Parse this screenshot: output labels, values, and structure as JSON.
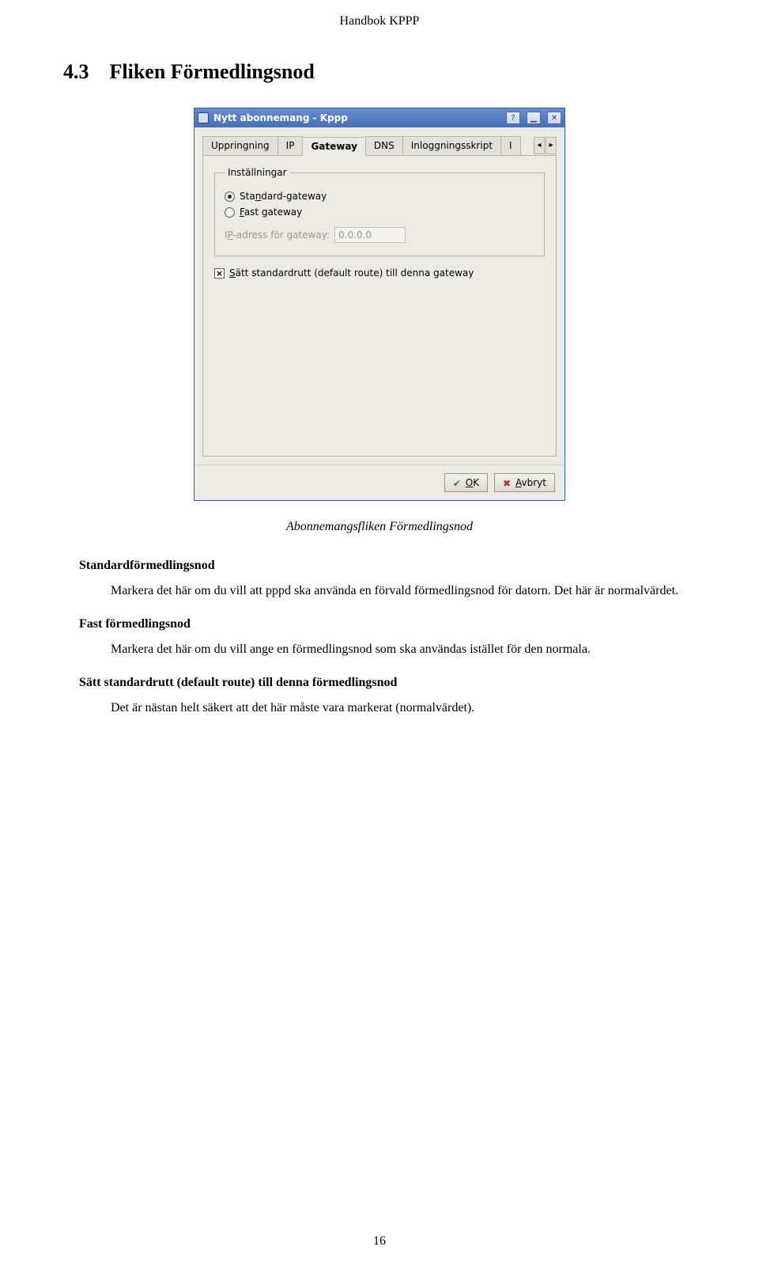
{
  "header": "Handbok KPPP",
  "section_number": "4.3",
  "section_title": "Fliken Förmedlingsnod",
  "window": {
    "title": "Nytt abonnemang - Kppp",
    "tabs": [
      "Uppringning",
      "IP",
      "Gateway",
      "DNS",
      "Inloggningsskript"
    ],
    "tab_overflow": "I",
    "fieldset_legend": "Inställningar",
    "radio_standard_pre": "Sta",
    "radio_standard_u": "n",
    "radio_standard_post": "dard-gateway",
    "radio_fast_u": "F",
    "radio_fast_post": "ast gateway",
    "ip_label_pre": "I",
    "ip_label_u": "P",
    "ip_label_post": "-adress för gateway:",
    "ip_value": "0.0.0.0",
    "defaultroute_u": "S",
    "defaultroute_post": "ätt standardrutt (default route) till denna gateway",
    "ok_u": "O",
    "ok_post": "K",
    "cancel_u": "A",
    "cancel_post": "vbryt"
  },
  "caption": "Abonnemangsfliken Förmedlingsnod",
  "terms": {
    "t1": "Standardförmedlingsnod",
    "d1": "Markera det här om du vill att pppd ska använda en förvald förmedlingsnod för datorn. Det här är normalvärdet.",
    "t2": "Fast förmedlingsnod",
    "d2": "Markera det här om du vill ange en förmedlingsnod som ska användas istället för den normala.",
    "t3": "Sätt standardrutt (default route) till denna förmedlingsnod",
    "d3": "Det är nästan helt säkert att det här måste vara markerat (normalvärdet)."
  },
  "page_number": "16"
}
